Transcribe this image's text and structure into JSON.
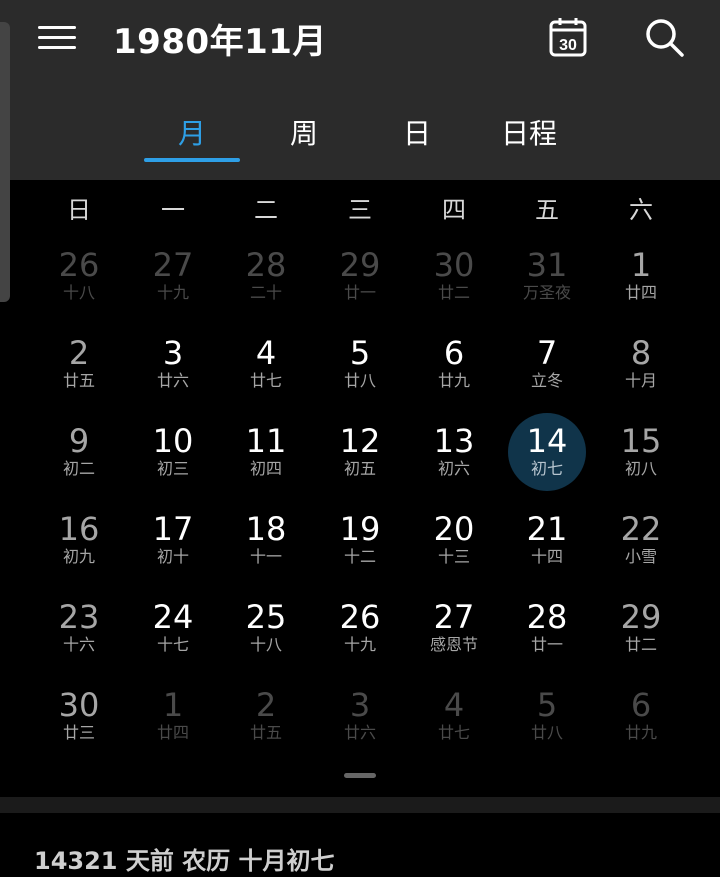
{
  "header": {
    "title": "1980年11月",
    "today_icon_day": "30",
    "icons": [
      "menu-icon",
      "today-icon",
      "search-icon"
    ]
  },
  "tabs": [
    {
      "label": "月",
      "active": true
    },
    {
      "label": "周",
      "active": false
    },
    {
      "label": "日",
      "active": false
    },
    {
      "label": "日程",
      "active": false
    }
  ],
  "weekdays": [
    "日",
    "一",
    "二",
    "三",
    "四",
    "五",
    "六"
  ],
  "weeks": [
    [
      {
        "day": "26",
        "lunar": "十八",
        "other": true
      },
      {
        "day": "27",
        "lunar": "十九",
        "other": true
      },
      {
        "day": "28",
        "lunar": "二十",
        "other": true
      },
      {
        "day": "29",
        "lunar": "廿一",
        "other": true
      },
      {
        "day": "30",
        "lunar": "廿二",
        "other": true
      },
      {
        "day": "31",
        "lunar": "万圣夜",
        "other": true
      },
      {
        "day": "1",
        "lunar": "廿四",
        "other": false
      }
    ],
    [
      {
        "day": "2",
        "lunar": "廿五",
        "other": false
      },
      {
        "day": "3",
        "lunar": "廿六",
        "other": false
      },
      {
        "day": "4",
        "lunar": "廿七",
        "other": false
      },
      {
        "day": "5",
        "lunar": "廿八",
        "other": false
      },
      {
        "day": "6",
        "lunar": "廿九",
        "other": false
      },
      {
        "day": "7",
        "lunar": "立冬",
        "other": false
      },
      {
        "day": "8",
        "lunar": "十月",
        "other": false
      }
    ],
    [
      {
        "day": "9",
        "lunar": "初二",
        "other": false
      },
      {
        "day": "10",
        "lunar": "初三",
        "other": false
      },
      {
        "day": "11",
        "lunar": "初四",
        "other": false
      },
      {
        "day": "12",
        "lunar": "初五",
        "other": false
      },
      {
        "day": "13",
        "lunar": "初六",
        "other": false
      },
      {
        "day": "14",
        "lunar": "初七",
        "other": false,
        "selected": true
      },
      {
        "day": "15",
        "lunar": "初八",
        "other": false
      }
    ],
    [
      {
        "day": "16",
        "lunar": "初九",
        "other": false
      },
      {
        "day": "17",
        "lunar": "初十",
        "other": false
      },
      {
        "day": "18",
        "lunar": "十一",
        "other": false
      },
      {
        "day": "19",
        "lunar": "十二",
        "other": false
      },
      {
        "day": "20",
        "lunar": "十三",
        "other": false
      },
      {
        "day": "21",
        "lunar": "十四",
        "other": false
      },
      {
        "day": "22",
        "lunar": "小雪",
        "other": false
      }
    ],
    [
      {
        "day": "23",
        "lunar": "十六",
        "other": false
      },
      {
        "day": "24",
        "lunar": "十七",
        "other": false
      },
      {
        "day": "25",
        "lunar": "十八",
        "other": false
      },
      {
        "day": "26",
        "lunar": "十九",
        "other": false
      },
      {
        "day": "27",
        "lunar": "感恩节",
        "other": false
      },
      {
        "day": "28",
        "lunar": "廿一",
        "other": false
      },
      {
        "day": "29",
        "lunar": "廿二",
        "other": false
      }
    ],
    [
      {
        "day": "30",
        "lunar": "廿三",
        "other": false
      },
      {
        "day": "1",
        "lunar": "廿四",
        "other": true
      },
      {
        "day": "2",
        "lunar": "廿五",
        "other": true
      },
      {
        "day": "3",
        "lunar": "廿六",
        "other": true
      },
      {
        "day": "4",
        "lunar": "廿七",
        "other": true
      },
      {
        "day": "5",
        "lunar": "廿八",
        "other": true
      },
      {
        "day": "6",
        "lunar": "廿九",
        "other": true
      }
    ]
  ],
  "footer": {
    "info": "14321 天前  农历 十月初七"
  },
  "colors": {
    "accent": "#2e9fe6",
    "selected_circle": "#10344a",
    "header_bg": "#2b2b2b",
    "background": "#000000"
  }
}
